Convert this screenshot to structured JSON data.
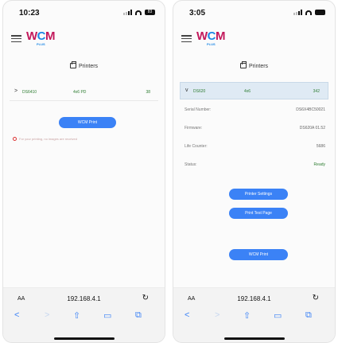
{
  "left": {
    "time": "10:23",
    "battery": "83",
    "logo": {
      "w": "W",
      "c": "C",
      "m": "M",
      "sub": "PLUS"
    },
    "section_title": "Printers",
    "printer": {
      "chevron": ">",
      "name": "DS6410",
      "size": "4x6 PD",
      "count": "38"
    },
    "print_button": "WCM Print",
    "notice": "For your printing, no images are received",
    "address": {
      "aa": "AA",
      "url": "192.168.4.1",
      "reload": "↻"
    }
  },
  "right": {
    "time": "3:05",
    "logo": {
      "w": "W",
      "c": "C",
      "m": "M",
      "sub": "PLUS"
    },
    "section_title": "Printers",
    "printer": {
      "chevron": "v",
      "name": "DS620",
      "size": "4x6",
      "count": "342"
    },
    "details": [
      {
        "key": "Serial Number:",
        "value": "DS6X4BC50021"
      },
      {
        "key": "Firmware:",
        "value": "DS620A 01.52"
      },
      {
        "key": "Life Counter:",
        "value": "5686"
      },
      {
        "key": "Status:",
        "value": "Ready"
      }
    ],
    "settings_button": "Printer Settings",
    "test_page_button": "Print Test Page",
    "print_button": "WCM Print",
    "address": {
      "aa": "AA",
      "url": "192.168.4.1",
      "reload": "↻"
    }
  },
  "toolbar_icons": {
    "back": "<",
    "forward": ">",
    "share": "share-icon",
    "bookmarks": "book-icon",
    "tabs": "tabs-icon"
  },
  "colors": {
    "accent": "#3b82f6",
    "brand_magenta": "#c2185b",
    "brand_blue": "#1e88e5",
    "status_green": "#2e7d32"
  }
}
